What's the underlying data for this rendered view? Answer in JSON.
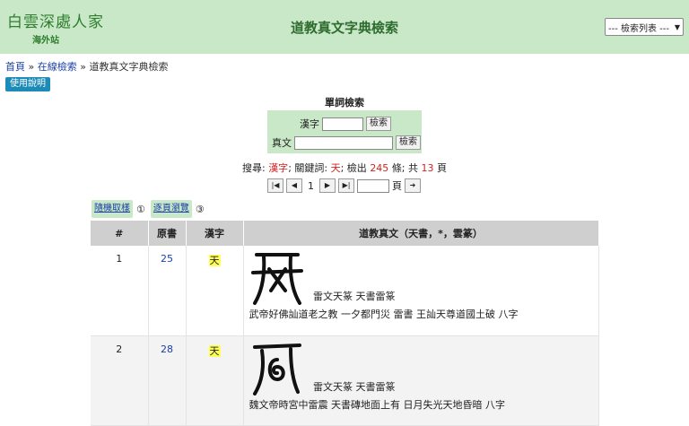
{
  "header": {
    "logo_text": "白雲深處人家",
    "logo_sub": "海外站",
    "title": "道教真文字典檢索",
    "select_value": "--- 檢索列表 ---"
  },
  "breadcrumb": {
    "home": "首頁",
    "sep": "»",
    "online": "在線檢索",
    "current": "道教真文字典檢索"
  },
  "help_button": "使用說明",
  "search": {
    "heading": "單詞檢索",
    "hanzi_label": "漢字",
    "zhenwen_label": "真文",
    "button": "檢索"
  },
  "status": {
    "prefix": "搜尋:",
    "term": "漢字",
    "keyword_label": "; 關鍵詞:",
    "keyword": "天",
    "found_label": "; 檢出",
    "found": "245",
    "items_label": "條; 共",
    "pages": "13",
    "pages_label": "頁"
  },
  "pager": {
    "current": "1",
    "page_label": "頁"
  },
  "options": {
    "random": "隨機取樣",
    "browse": "逐頁瀏覽",
    "n1": "①",
    "n3": "③"
  },
  "table": {
    "headers": [
      "#",
      "原書",
      "漢字",
      "道教真文（天書，*，雲篆）"
    ],
    "rows": [
      {
        "num": "1",
        "book": "25",
        "hanzi": "天",
        "caption": "雷文天篆 天書雷篆",
        "desc": "武帝好佛訕道老之教 一夕都門災 雷書 王訕天尊道國土破 八字"
      },
      {
        "num": "2",
        "book": "28",
        "hanzi": "天",
        "caption": "雷文天篆 天書雷篆",
        "desc": "魏文帝時宮中雷震 天書磚地面上有 日月失光天地昏暗 八字"
      }
    ]
  },
  "colors": {
    "accent_green": "#c8e8c8",
    "link_blue": "#1a3fa8",
    "highlight": "#ffff55",
    "red": "#d42020",
    "help_button": "#1c8bb8"
  },
  "icons": [
    "first-page-icon",
    "prev-page-icon",
    "next-page-icon",
    "last-page-icon",
    "go-icon",
    "chevron-down-icon"
  ]
}
